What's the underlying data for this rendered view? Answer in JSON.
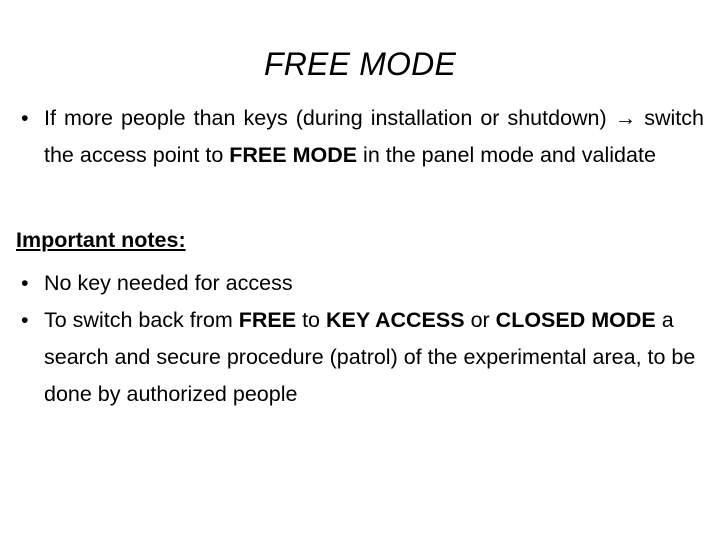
{
  "slide": {
    "title": "FREE MODE",
    "bullet_glyph": "•",
    "arrow_glyph": "→",
    "text_color": "#000000",
    "background_color": "#ffffff",
    "sections": {
      "first_bullet": {
        "part1": "If more people than keys (during installation or shutdown) ",
        "arrow": "→",
        "part2": " switch the access point to ",
        "emphasis1": "FREE MODE",
        "part3": " in the panel mode and validate"
      },
      "notes_heading": "Important notes:",
      "note1": "No key needed for access",
      "note2": {
        "part1": "To switch back from ",
        "emphasis1": "FREE",
        "part2": " to ",
        "emphasis2": "KEY ACCESS",
        "part3": " or ",
        "emphasis3": "CLOSED MODE",
        "part4": " a search and secure procedure (patrol) of the experimental area, to be done by authorized people"
      }
    }
  }
}
